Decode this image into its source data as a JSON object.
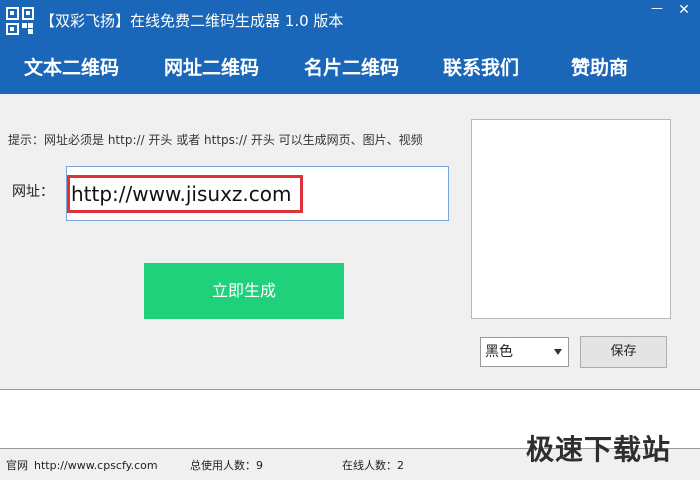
{
  "window": {
    "title": "【双彩飞扬】在线免费二维码生成器 1.0 版本",
    "minimize_glyph": "—",
    "close_glyph": "✕"
  },
  "nav": {
    "items": [
      {
        "label": "文本二维码"
      },
      {
        "label": "网址二维码"
      },
      {
        "label": "名片二维码"
      },
      {
        "label": "联系我们"
      },
      {
        "label": "赞助商"
      }
    ]
  },
  "form": {
    "hint": "提示：网址必须是 http:// 开头 或者 https:// 开头  可以生成网页、图片、视频",
    "url_label": "网址：",
    "url_value": "http://www.jisuxz.com",
    "generate_label": "立即生成"
  },
  "options": {
    "color_selected": "黑色",
    "save_label": "保存"
  },
  "status": {
    "site_label": "官网",
    "site_url": "http://www.cpscfy.com",
    "total_users": "总使用人数：9",
    "online_users": "在线人数：2"
  },
  "watermark": "极速下载站",
  "colors": {
    "brand_blue": "#1a66b8",
    "generate_green": "#1ed17a",
    "highlight_red": "#e0323a"
  },
  "icons": {
    "app": "qr-app-icon",
    "minimize": "minimize-icon",
    "close": "close-icon",
    "dropdown": "chevron-down-icon"
  }
}
